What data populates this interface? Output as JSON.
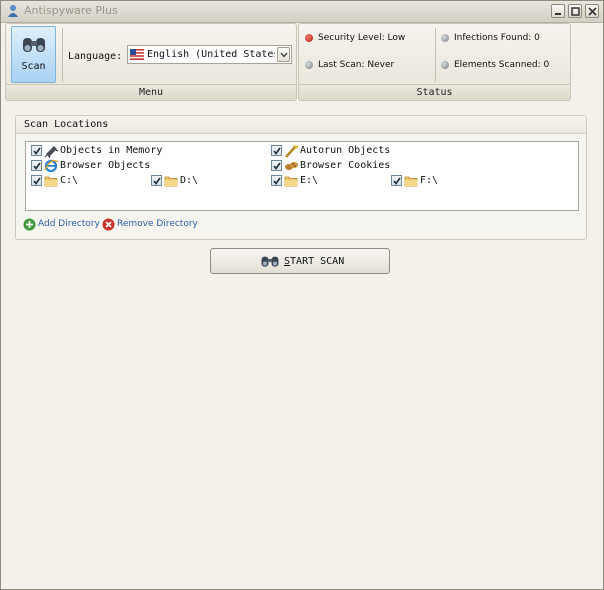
{
  "window": {
    "title": "Antispyware Plus"
  },
  "ribbon": {
    "menu_group_label": "Menu",
    "status_group_label": "Status",
    "scan_button_label": "Scan",
    "language_label": "Language:",
    "language_value": "English (United States)",
    "status": {
      "security_level": "Security Level: Low",
      "last_scan": "Last Scan: Never",
      "infections_found": "Infections Found: 0",
      "elements_scanned": "Elements Scanned: 0"
    }
  },
  "scan_locations": {
    "title": "Scan Locations",
    "items": [
      {
        "label": "Objects in Memory",
        "checked": true,
        "icon": "memory-chip-icon"
      },
      {
        "label": "Autorun Objects",
        "checked": true,
        "icon": "autorun-wand-icon"
      },
      {
        "label": "Browser Objects",
        "checked": true,
        "icon": "internet-explorer-icon"
      },
      {
        "label": "Browser Cookies",
        "checked": true,
        "icon": "cookie-icon"
      },
      {
        "label": "C:\\",
        "checked": true,
        "icon": "folder-icon"
      },
      {
        "label": "D:\\",
        "checked": true,
        "icon": "folder-icon"
      },
      {
        "label": "E:\\",
        "checked": true,
        "icon": "folder-icon"
      },
      {
        "label": "F:\\",
        "checked": true,
        "icon": "folder-icon"
      }
    ],
    "add_directory": "Add Directory",
    "remove_directory": "Remove Directory"
  },
  "actions": {
    "start_scan_label": "TART SCAN",
    "start_scan_mnemonic": "S"
  },
  "colors": {
    "status_red": "#cc2a1f",
    "status_gray": "#8b8f95",
    "link_blue": "#2d5fa8",
    "scan_button_blue": "#a9d2f3"
  }
}
